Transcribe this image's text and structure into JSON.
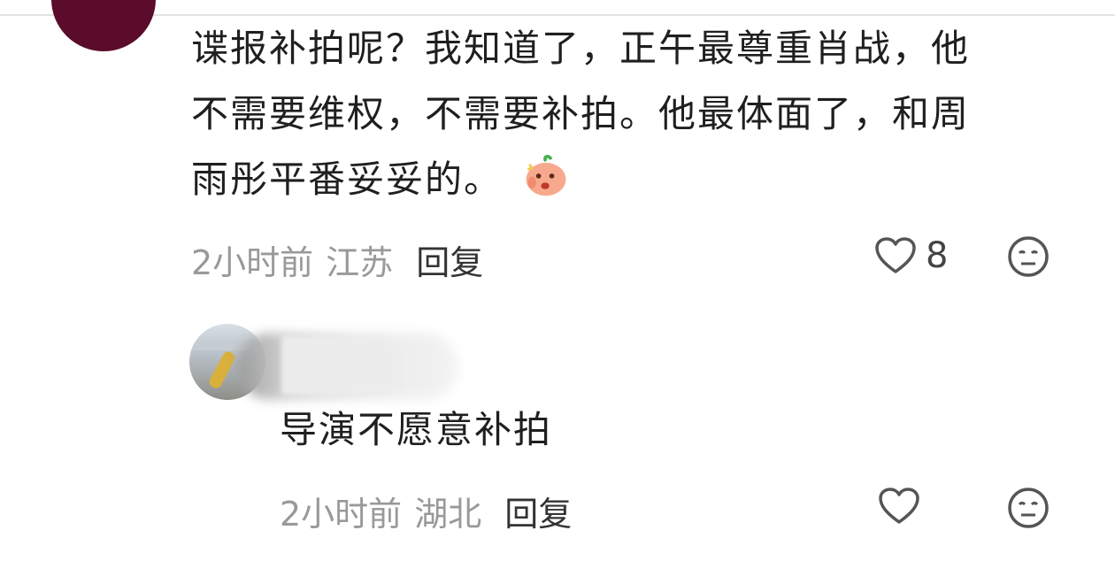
{
  "comment": {
    "lines": [
      "谍报补拍呢？我知道了，正午最尊重肖战，他",
      "不需要维权，不需要补拍。他最体面了，和周",
      "雨彤平番妥妥的。"
    ],
    "emoji": "angry-peach-emoji",
    "time": "2小时前",
    "location": "江苏",
    "reply_label": "回复",
    "like_count": "8"
  },
  "reply": {
    "text": "导演不愿意补拍",
    "time": "2小时前",
    "location": "湖北",
    "reply_label": "回复"
  },
  "colors": {
    "avatar_top": "#5a0c2a",
    "meta_text": "#999999",
    "icon_stroke": "#555555"
  }
}
